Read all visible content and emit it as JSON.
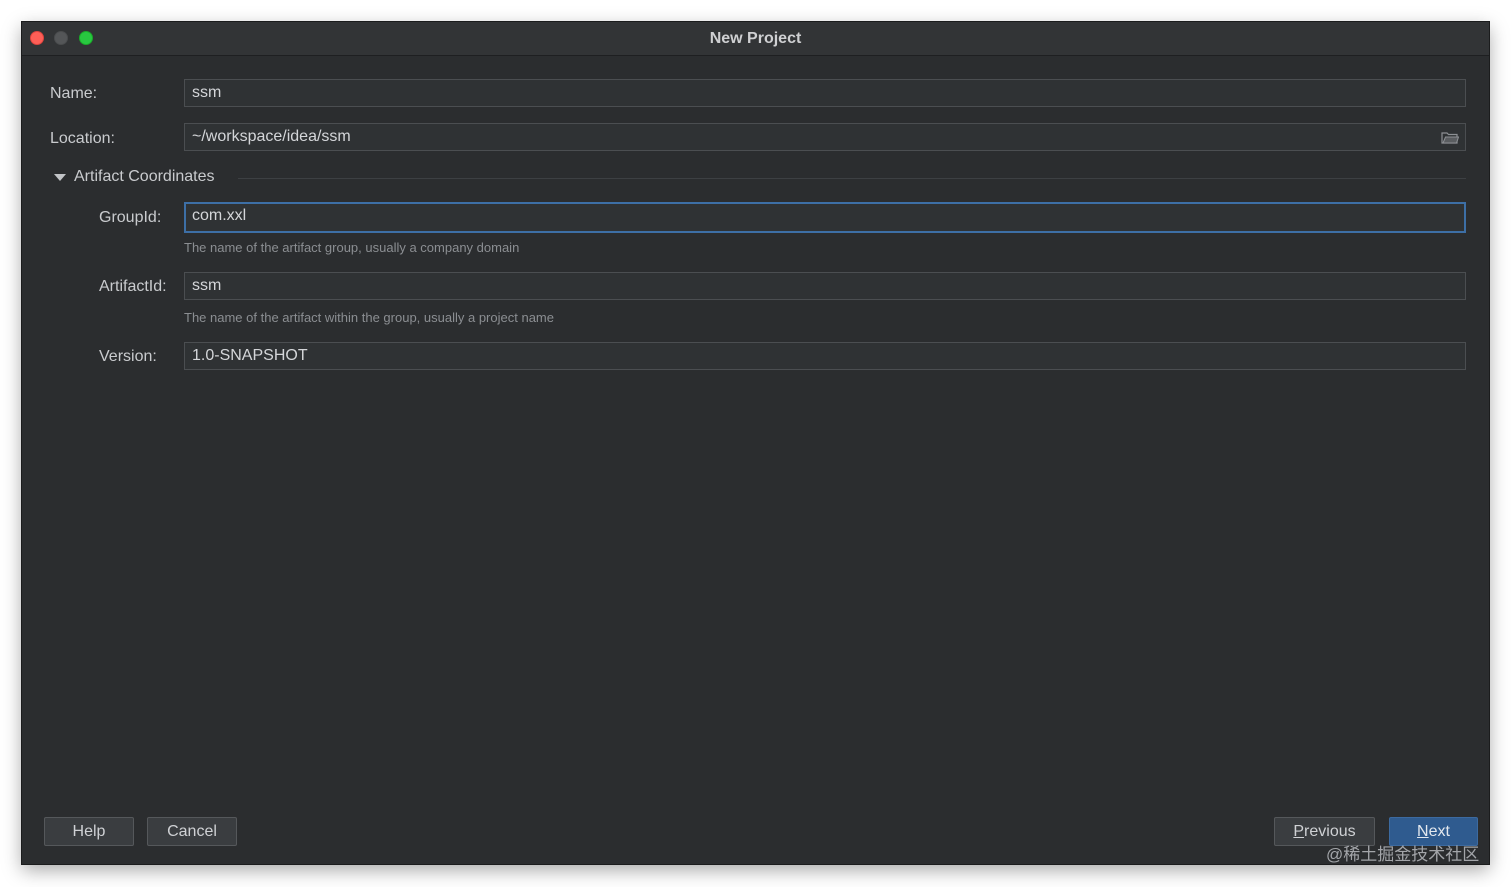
{
  "window": {
    "title": "New Project"
  },
  "form": {
    "name": {
      "label": "Name:",
      "value": "ssm"
    },
    "location": {
      "label": "Location:",
      "value": "~/workspace/idea/ssm"
    },
    "section": {
      "label": "Artifact Coordinates",
      "expanded": true
    },
    "group_id": {
      "label": "GroupId:",
      "value": "com.xxl",
      "hint": "The name of the artifact group, usually a company domain"
    },
    "artifact_id": {
      "label": "ArtifactId:",
      "value": "ssm",
      "hint": "The name of the artifact within the group, usually a project name"
    },
    "version": {
      "label": "Version:",
      "value": "1.0-SNAPSHOT"
    }
  },
  "buttons": {
    "help": "Help",
    "cancel": "Cancel",
    "previous_mnemonic": "P",
    "previous_rest": "revious",
    "next_mnemonic": "N",
    "next_rest": "ext"
  },
  "watermark": "@稀土掘金技术社区",
  "icons": {
    "location_browse": "folder-icon",
    "section_toggle": "triangle-down-icon"
  },
  "colors": {
    "background": "#2b2d2f",
    "focus_border": "#3d6fa6",
    "primary_button": "#2f5b8f",
    "close": "#fe5f57",
    "maximize": "#28c840"
  }
}
